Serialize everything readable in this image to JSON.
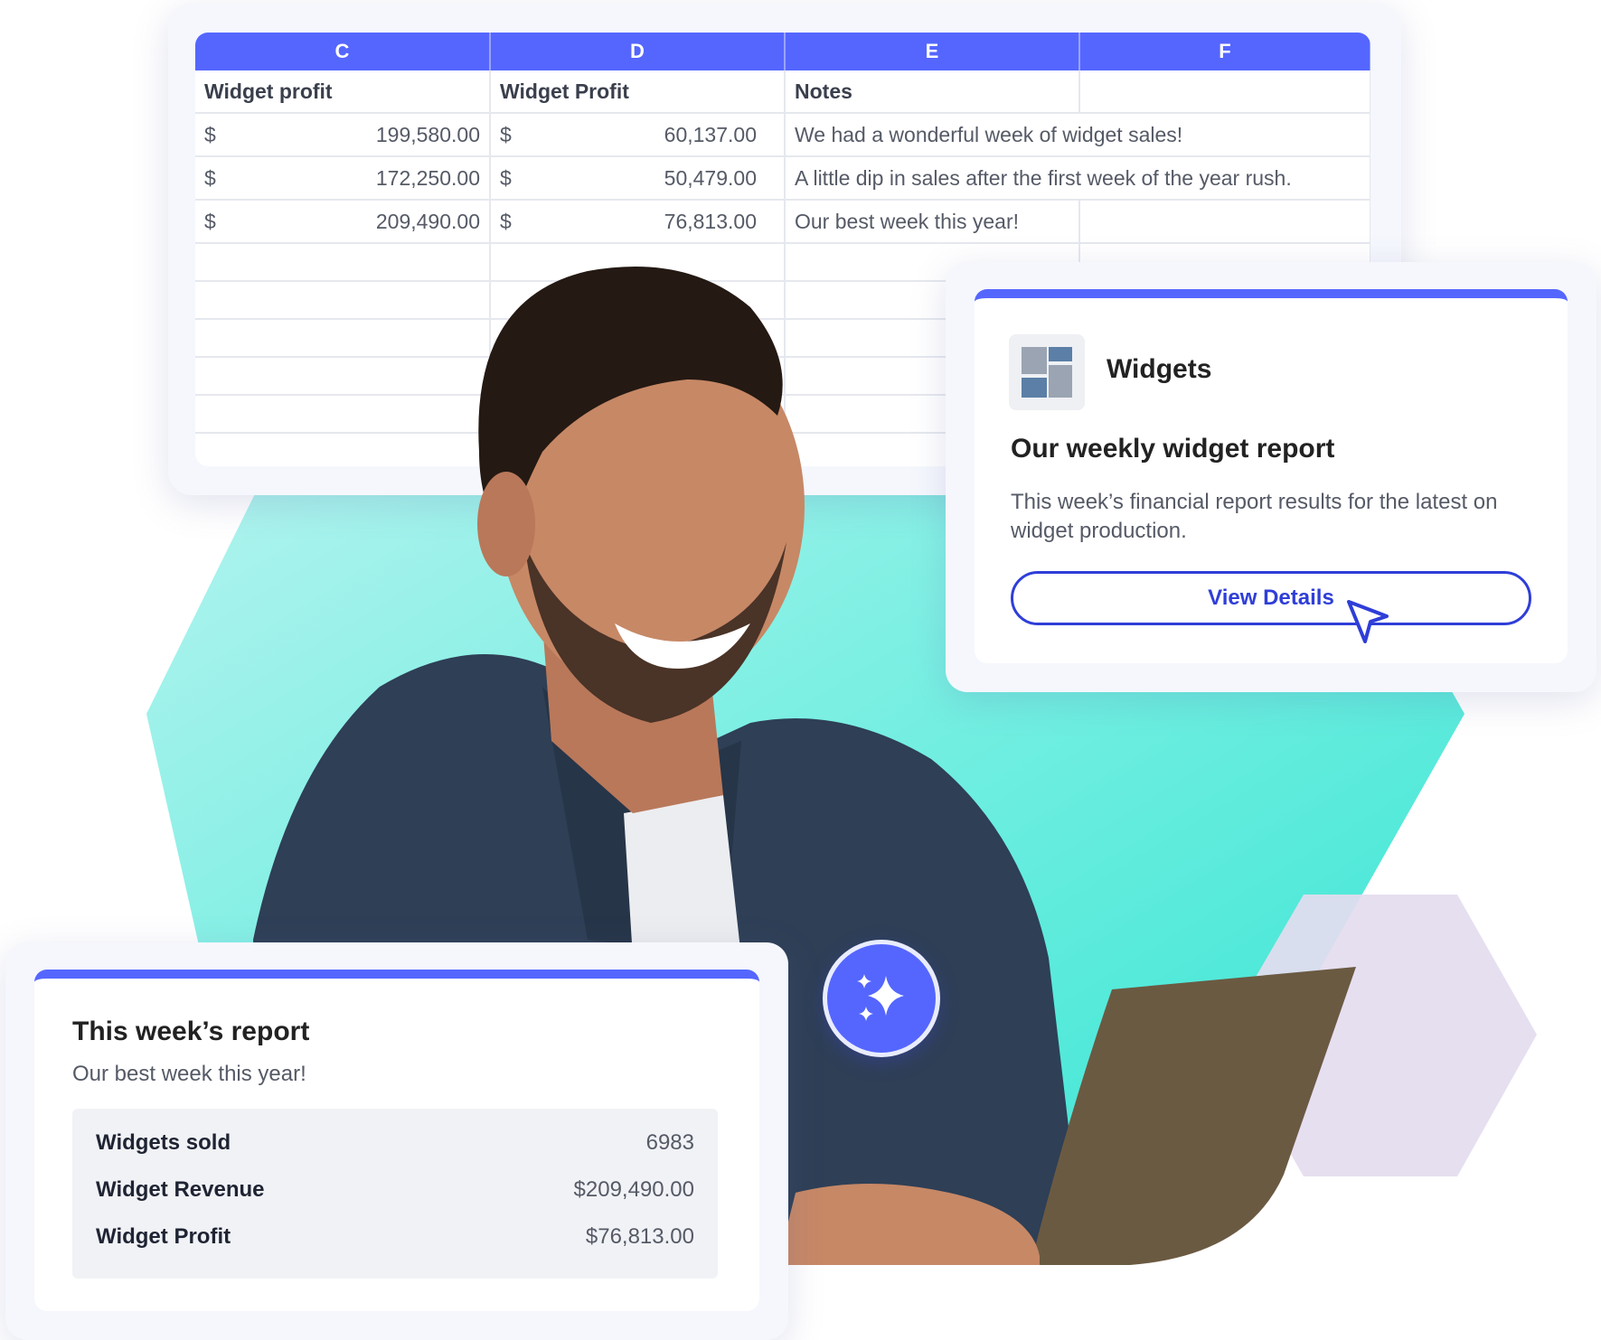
{
  "spreadsheet": {
    "columns": [
      "C",
      "D",
      "E",
      "F"
    ],
    "header": {
      "c": "Widget profit",
      "d": "Widget Profit",
      "e": "Notes"
    },
    "rows": [
      {
        "c_cur": "$",
        "c_val": "199,580.00",
        "d_cur": "$",
        "d_val": "60,137.00",
        "note": "We had a wonderful week of widget sales!"
      },
      {
        "c_cur": "$",
        "c_val": "172,250.00",
        "d_cur": "$",
        "d_val": "50,479.00",
        "note": "A little dip in sales after the first week of the year rush."
      },
      {
        "c_cur": "$",
        "c_val": "209,490.00",
        "d_cur": "$",
        "d_val": "76,813.00",
        "note": "Our best week this year!"
      }
    ]
  },
  "widget_card": {
    "name": "Widgets",
    "title": "Our weekly widget report",
    "description": "This week’s financial report results for the latest on widget production.",
    "button_label": "View Details",
    "icon": "dashboard-layout-icon"
  },
  "report_card": {
    "title": "This week’s report",
    "subtitle": "Our best week this year!",
    "stats": [
      {
        "label": "Widgets sold",
        "value": "6983"
      },
      {
        "label": "Widget Revenue",
        "value": "$209,490.00"
      },
      {
        "label": "Widget Profit",
        "value": "$76,813.00"
      }
    ]
  },
  "badge": {
    "icon": "sparkles-icon"
  },
  "colors": {
    "accent": "#5566ff",
    "button_border": "#2f3ed8",
    "teal": "#3ce6d6",
    "lavender": "#e4dcef"
  }
}
